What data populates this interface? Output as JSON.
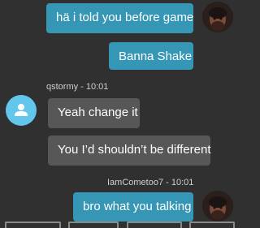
{
  "messages": [
    {
      "text": "hä i told you before game"
    },
    {
      "text": "Banna Shake"
    },
    {
      "text": "Yeah change it"
    },
    {
      "text": "You I’d shouldn’t be different"
    },
    {
      "text": "bro what you talking"
    }
  ],
  "senders": {
    "qstormy": "qstormy - 10:01",
    "iamcometoo7": "IamCometoo7 - 10:01"
  },
  "icons": {
    "self_avatar": "user-photo-avatar",
    "other_avatar": "person-icon"
  },
  "colors": {
    "own_bubble": "#3596b5",
    "other_bubble": "#575757",
    "background": "#303030",
    "default_avatar": "#63c7ec"
  }
}
